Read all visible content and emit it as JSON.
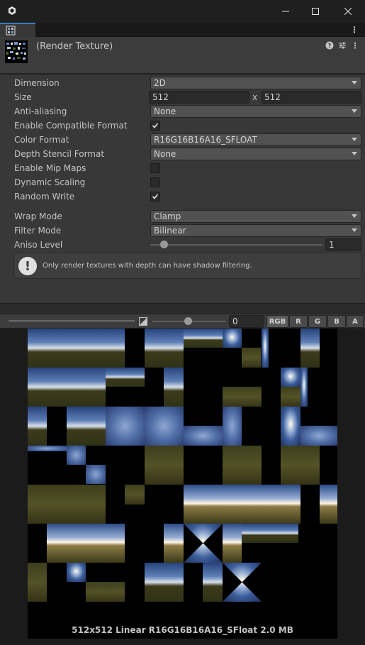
{
  "window": {
    "minimize_icon": "minimize-icon",
    "maximize_icon": "maximize-icon",
    "close_icon": "close-icon"
  },
  "header": {
    "title": "(Render Texture)",
    "icons": [
      "help-icon",
      "settings-sliders-icon",
      "kebab-menu-icon"
    ]
  },
  "properties": {
    "dimension": {
      "label": "Dimension",
      "value": "2D"
    },
    "size": {
      "label": "Size",
      "width": "512",
      "sep": "x",
      "height": "512"
    },
    "anti_aliasing": {
      "label": "Anti-aliasing",
      "value": "None"
    },
    "enable_compatible_format": {
      "label": "Enable Compatible Format",
      "checked": true
    },
    "color_format": {
      "label": "Color Format",
      "value": "R16G16B16A16_SFLOAT"
    },
    "depth_stencil_format": {
      "label": "Depth Stencil Format",
      "value": "None"
    },
    "enable_mip_maps": {
      "label": "Enable Mip Maps",
      "checked": false
    },
    "dynamic_scaling": {
      "label": "Dynamic Scaling",
      "checked": false
    },
    "random_write": {
      "label": "Random Write",
      "checked": true
    },
    "wrap_mode": {
      "label": "Wrap Mode",
      "value": "Clamp"
    },
    "filter_mode": {
      "label": "Filter Mode",
      "value": "Bilinear"
    },
    "aniso_level": {
      "label": "Aniso Level",
      "value": "1",
      "slider_fraction": 0.06
    }
  },
  "help": {
    "text": "Only render textures with depth can have shadow filtering."
  },
  "preview_toolbar": {
    "mip_value": "0",
    "mip_slider_fraction": 0.47,
    "channels": [
      "RGB",
      "R",
      "G",
      "B",
      "A"
    ],
    "active_channel": "RGB"
  },
  "preview": {
    "info": "512x512 Linear  R16G16B16A16_SFloat  2.0 MB"
  }
}
